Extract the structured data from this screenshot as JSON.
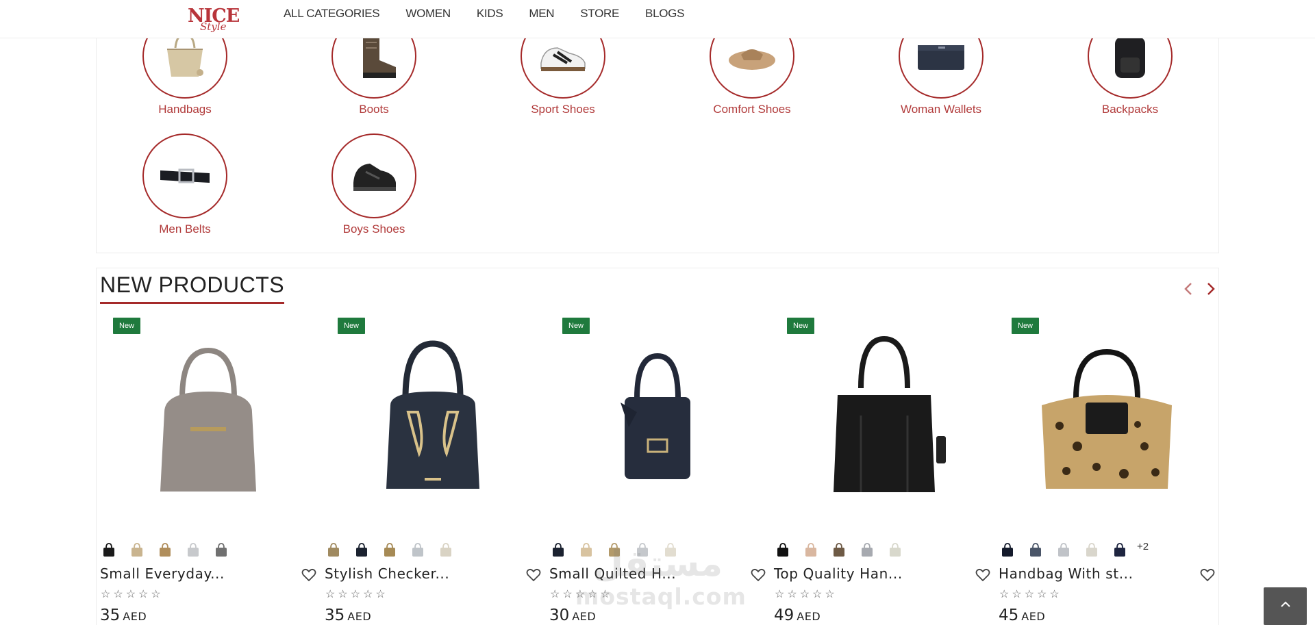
{
  "brand": {
    "logo_top": "NICE",
    "logo_bottom": "Style",
    "accent": "#a52a2a"
  },
  "nav": [
    "ALL CATEGORIES",
    "WOMEN",
    "KIDS",
    "MEN",
    "STORE",
    "BLOGS"
  ],
  "categories": [
    {
      "label": "Handbags",
      "icon": "handbag-image"
    },
    {
      "label": "Boots",
      "icon": "boot-image"
    },
    {
      "label": "Sport Shoes",
      "icon": "sneaker-image"
    },
    {
      "label": "Comfort Shoes",
      "icon": "sandal-image"
    },
    {
      "label": "Woman Wallets",
      "icon": "wallet-image"
    },
    {
      "label": "Backpacks",
      "icon": "backpack-image"
    },
    {
      "label": "Men Belts",
      "icon": "belt-image"
    },
    {
      "label": "Boys Shoes",
      "icon": "kids-shoe-image"
    }
  ],
  "new_products": {
    "title": "NEW PRODUCTS",
    "badge": "New",
    "items": [
      {
        "name": "Small Everyday...",
        "price": "35",
        "currency": "AED",
        "swatch_colors": [
          "#1a1a1a",
          "#c9b48f",
          "#b08e5c",
          "#c7c9cc",
          "#707070"
        ],
        "more": ""
      },
      {
        "name": "Stylish Checker...",
        "price": "35",
        "currency": "AED",
        "swatch_colors": [
          "#a08a60",
          "#1b2230",
          "#a68a55",
          "#bfc4c9",
          "#d9d3c4"
        ],
        "more": ""
      },
      {
        "name": "Small Quilted H...",
        "price": "30",
        "currency": "AED",
        "swatch_colors": [
          "#1b2230",
          "#d8c3a0",
          "#b39a6a",
          "#c5c8cc",
          "#e2ddd0"
        ],
        "more": ""
      },
      {
        "name": "Top Quality Han...",
        "price": "49",
        "currency": "AED",
        "swatch_colors": [
          "#111111",
          "#d9b7a0",
          "#6e5a45",
          "#a7aab0",
          "#d8d8cc"
        ],
        "more": ""
      },
      {
        "name": "Handbag With st...",
        "price": "45",
        "currency": "AED",
        "swatch_colors": [
          "#141a2b",
          "#4a5568",
          "#c0c3c8",
          "#d9d6cc",
          "#1e2540"
        ],
        "more": "+2"
      }
    ]
  },
  "watermark": {
    "arabic": "مستقل",
    "latin": "mostaql.com"
  }
}
